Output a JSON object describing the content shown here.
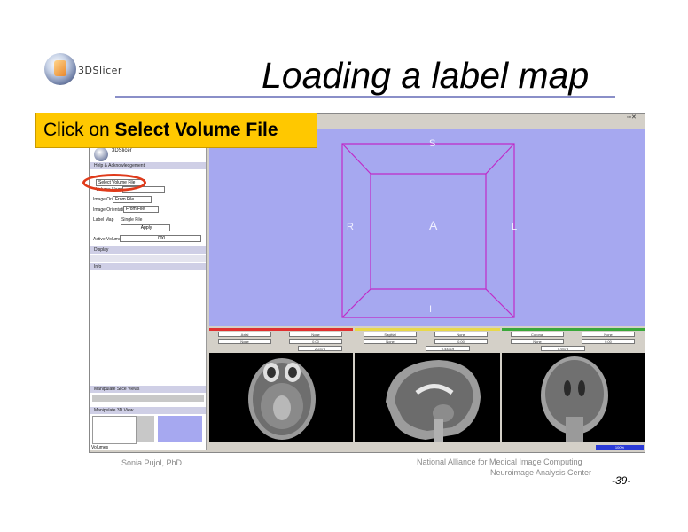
{
  "slide": {
    "title": "Loading a label map",
    "logo_text": "3DSlicer",
    "callout_prefix": "Click on ",
    "callout_bold": "Select Volume File",
    "author": "Sonia Pujol, PhD",
    "org_line1": "National Alliance for Medical Image Computing",
    "org_line2": "Neuroimage Analysis Center",
    "page_number": "-39-"
  },
  "app": {
    "panel_title": "3DSlicer",
    "sections": {
      "help": "Help & Acknowledgement",
      "display": "Display",
      "info": "Info"
    },
    "form": {
      "select_volume_button": "Select Volume File",
      "volume_name_label": "Volume Name",
      "image_origin_label": "Image Origin",
      "image_origin_value": "From File",
      "image_orientation_label": "Image Orientation",
      "image_orientation_value": "From File",
      "label_map_label": "Label Map",
      "single_file_label": "Single File",
      "apply_button": "Apply",
      "active_volume_label": "Active Volume",
      "active_volume_value": "000"
    },
    "bottom_sections": {
      "slice_views": "Manipulate Slice Views",
      "fov_views": "Manipulate 3D View"
    },
    "status_label": "Volumes",
    "progress_text": "100%",
    "orientation": {
      "top": "S",
      "bottom": "I",
      "left": "R",
      "right": "L",
      "center": "A"
    },
    "slice_controls": [
      {
        "color": "#e03030",
        "values": [
          "Axial",
          "None",
          "None",
          "0.00"
        ],
        "offset": "2.2376"
      },
      {
        "color": "#e8d84a",
        "values": [
          "Sagittal",
          "None",
          "None",
          "0.00"
        ],
        "offset": "0.44319"
      },
      {
        "color": "#3aa83a",
        "values": [
          "Coronal",
          "None",
          "None",
          "0.00"
        ],
        "offset": "0.9375"
      }
    ]
  },
  "colors": {
    "callout_bg": "#ffc800",
    "view3d_bg": "#a6a8f0",
    "ellipse": "#e03a1a",
    "title_rule": "#8a8fc8"
  }
}
